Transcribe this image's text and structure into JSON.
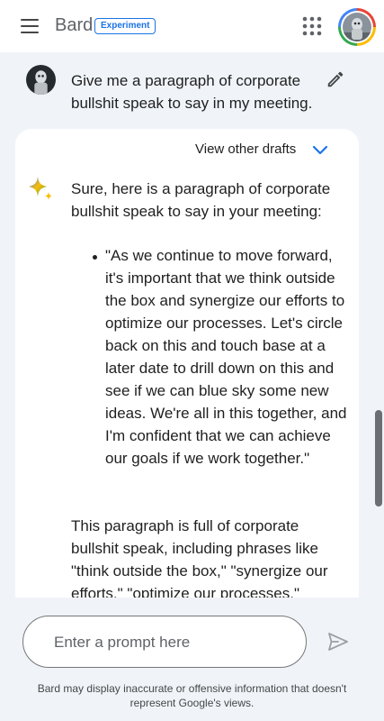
{
  "header": {
    "brand": "Bard",
    "badge": "Experiment",
    "menu_icon": "hamburger-menu-icon",
    "apps_icon": "apps-grid-icon",
    "avatar_icon": "user-avatar"
  },
  "conversation": {
    "user_message": "Give me a paragraph of corporate bullshit speak to say in my meeting.",
    "edit_icon": "pencil-edit-icon",
    "view_drafts_label": "View other drafts",
    "response_intro": "Sure, here is a paragraph of corporate bullshit speak to say in your meeting:",
    "response_quote": "\"As we continue to move forward, it's important that we think outside the box and synergize our efforts to optimize our processes. Let's circle back on this and touch base at a later date to drill down on this and see if we can blue sky some new ideas. We're all in this together, and I'm confident that we can achieve our goals if we work together.\"",
    "response_outro": "This paragraph is full of corporate bullshit speak, including phrases like \"think outside the box,\" \"synergize our efforts,\" \"optimize our processes,\""
  },
  "input": {
    "placeholder": "Enter a prompt here",
    "value": "",
    "send_icon": "send-icon"
  },
  "footer": {
    "disclaimer": "Bard may display inaccurate or offensive information that doesn't represent Google's views."
  },
  "colors": {
    "accent": "#1a73e8",
    "background": "#f0f4f9",
    "surface": "#ffffff"
  }
}
